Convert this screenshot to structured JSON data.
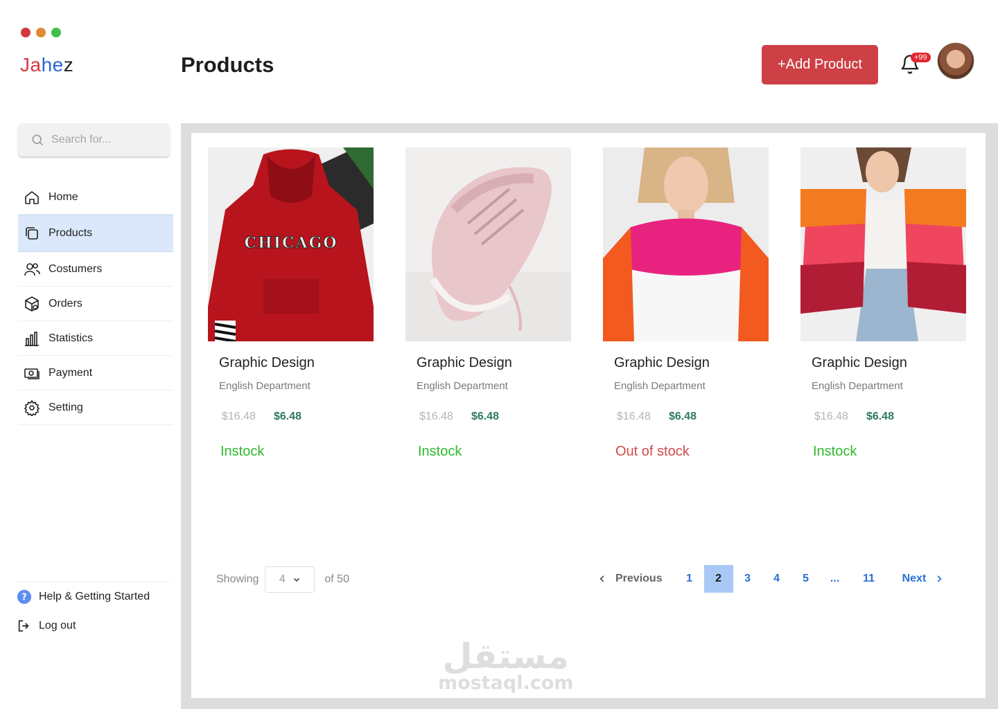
{
  "window": {
    "dot_colors": [
      "#d0393f",
      "#e08a35",
      "#3fc04a"
    ]
  },
  "brand": {
    "logo_parts": [
      {
        "text": "Ja",
        "color": "#d33b42"
      },
      {
        "text": "he",
        "color": "#2a66d9"
      },
      {
        "text": "z",
        "color": "#222222"
      }
    ]
  },
  "header": {
    "title": "Products",
    "add_button_label": "+Add Product",
    "notification_count": "+99",
    "accent_color": "#cd4146"
  },
  "search": {
    "placeholder": "Search for..."
  },
  "sidebar": {
    "items": [
      {
        "label": "Home",
        "icon": "home-icon",
        "active": false
      },
      {
        "label": "Products",
        "icon": "products-icon",
        "active": true
      },
      {
        "label": "Costumers",
        "icon": "customers-icon",
        "active": false
      },
      {
        "label": "Orders",
        "icon": "orders-icon",
        "active": false
      },
      {
        "label": "Statistics",
        "icon": "statistics-icon",
        "active": false
      },
      {
        "label": "Payment",
        "icon": "payment-icon",
        "active": false
      },
      {
        "label": "Setting",
        "icon": "settings-icon",
        "active": false
      }
    ],
    "help_label": "Help & Getting Started",
    "logout_label": "Log out"
  },
  "products": [
    {
      "title": "Graphic Design",
      "department": "English Department",
      "old_price": "$16.48",
      "new_price": "$6.48",
      "stock": "Instock",
      "stock_color": "#2eb82e"
    },
    {
      "title": "Graphic Design",
      "department": "English Department",
      "old_price": "$16.48",
      "new_price": "$6.48",
      "stock": "Instock",
      "stock_color": "#2eb82e"
    },
    {
      "title": "Graphic Design",
      "department": "English Department",
      "old_price": "$16.48",
      "new_price": "$6.48",
      "stock": "Out of stock",
      "stock_color": "#cf4a4a"
    },
    {
      "title": "Graphic Design",
      "department": "English Department",
      "old_price": "$16.48",
      "new_price": "$6.48",
      "stock": "Instock",
      "stock_color": "#2eb82e"
    }
  ],
  "pagination": {
    "showing_label": "Showing",
    "per_page": "4",
    "of_label": "of 50",
    "previous_label": "Previous",
    "next_label": "Next",
    "pages": [
      "1",
      "2",
      "3",
      "4",
      "5",
      "...",
      "11"
    ],
    "current_page": "2"
  },
  "watermark": {
    "arabic": "مستقل",
    "latin": "mostaql.com"
  }
}
